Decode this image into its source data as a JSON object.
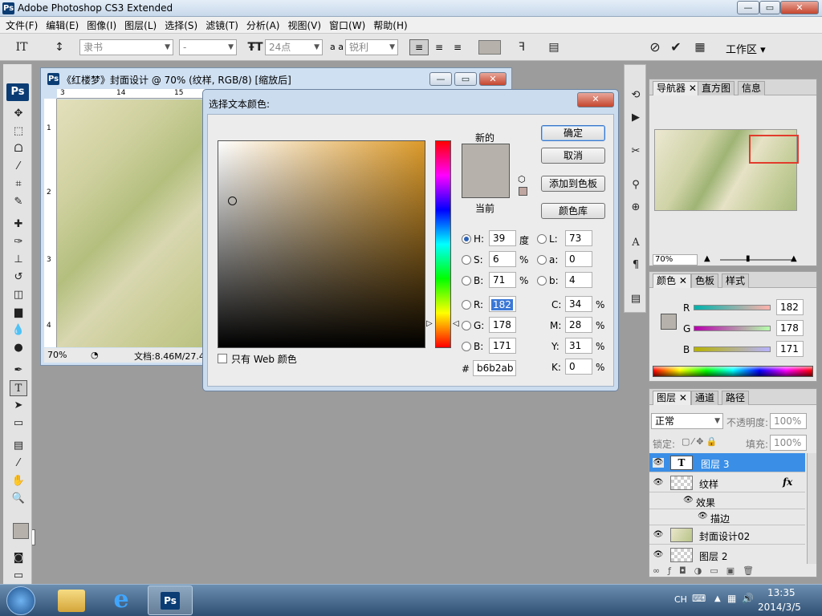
{
  "app": {
    "title": "Adobe Photoshop CS3 Extended",
    "icon_text": "Ps",
    "window_buttons": [
      "—",
      "▭",
      "✕"
    ]
  },
  "menu": [
    "文件(F)",
    "编辑(E)",
    "图像(I)",
    "图层(L)",
    "选择(S)",
    "滤镜(T)",
    "分析(A)",
    "视图(V)",
    "窗口(W)",
    "帮助(H)"
  ],
  "options_bar": {
    "tool_icon": "IT",
    "font_family": "隶书",
    "font_style": "-",
    "font_size": "24点",
    "aa_label": "a a",
    "antialias": "锐利",
    "workspace": "工作区 ▾",
    "icons": [
      "text-tool-icon",
      "orientation-icon",
      "align-left-icon",
      "align-center-icon",
      "align-right-icon",
      "color-swatch",
      "warp-text-icon",
      "palettes-icon",
      "cancel-icon",
      "commit-icon",
      "bridge-icon"
    ],
    "swatch_color": "#b6b2ab"
  },
  "document": {
    "title": "《红楼梦》封面设计 @ 70% (纹样, RGB/8) [缩放后]",
    "ruler_h": [
      "3",
      "14",
      "15"
    ],
    "ruler_v": [
      "1",
      "2",
      "3",
      "4"
    ],
    "zoom": "70%",
    "status": "文档:8.46M/27.4"
  },
  "color_picker": {
    "title": "选择文本颜色:",
    "close": "✕",
    "new_label": "新的",
    "current_label": "当前",
    "new_color": "#b6b2ab",
    "current_color": "#b6b2ab",
    "buttons": {
      "ok": "确定",
      "cancel": "取消",
      "add_swatch": "添加到色板",
      "libraries": "颜色库"
    },
    "hsb": {
      "h_label": "H:",
      "h": "39",
      "h_unit": "度",
      "s_label": "S:",
      "s": "6",
      "s_unit": "%",
      "b_label": "B:",
      "b": "71",
      "b_unit": "%"
    },
    "rgb": {
      "r_label": "R:",
      "r": "182",
      "g_label": "G:",
      "g": "178",
      "b_label": "B:",
      "b": "171"
    },
    "lab": {
      "l_label": "L:",
      "l": "73",
      "a_label": "a:",
      "a": "0",
      "b_label": "b:",
      "b": "4"
    },
    "cmyk": {
      "c_label": "C:",
      "c": "34",
      "m_label": "M:",
      "m": "28",
      "y_label": "Y:",
      "y": "31",
      "k_label": "K:",
      "k": "0",
      "unit": "%"
    },
    "hex_label": "#",
    "hex": "b6b2ab",
    "web_only_label": "只有 Web 颜色",
    "field_color": "#dc9a2a"
  },
  "navigator_panel": {
    "tabs": [
      "导航器",
      "直方图",
      "信息"
    ],
    "zoom": "70%"
  },
  "color_panel": {
    "tabs": [
      "颜色",
      "色板",
      "样式"
    ],
    "r_label": "R",
    "r": "182",
    "g_label": "G",
    "g": "178",
    "b_label": "B",
    "b": "171"
  },
  "layers_panel": {
    "tabs": [
      "图层",
      "通道",
      "路径"
    ],
    "blend_mode": "正常",
    "opacity_label": "不透明度:",
    "opacity": "100%",
    "lock_label": "锁定:",
    "fill_label": "填充:",
    "fill": "100%",
    "layers": [
      {
        "name": "图层 3",
        "type": "text",
        "selected": true
      },
      {
        "name": "纹样",
        "type": "raster",
        "fx": "fx"
      },
      {
        "name": "效果",
        "type": "effect-group"
      },
      {
        "name": "描边",
        "type": "effect"
      },
      {
        "name": "封面设计02",
        "type": "raster"
      },
      {
        "name": "图层 2",
        "type": "raster"
      }
    ]
  },
  "taskbar": {
    "ime": "CH",
    "time": "13:35",
    "date": "2014/3/5"
  }
}
